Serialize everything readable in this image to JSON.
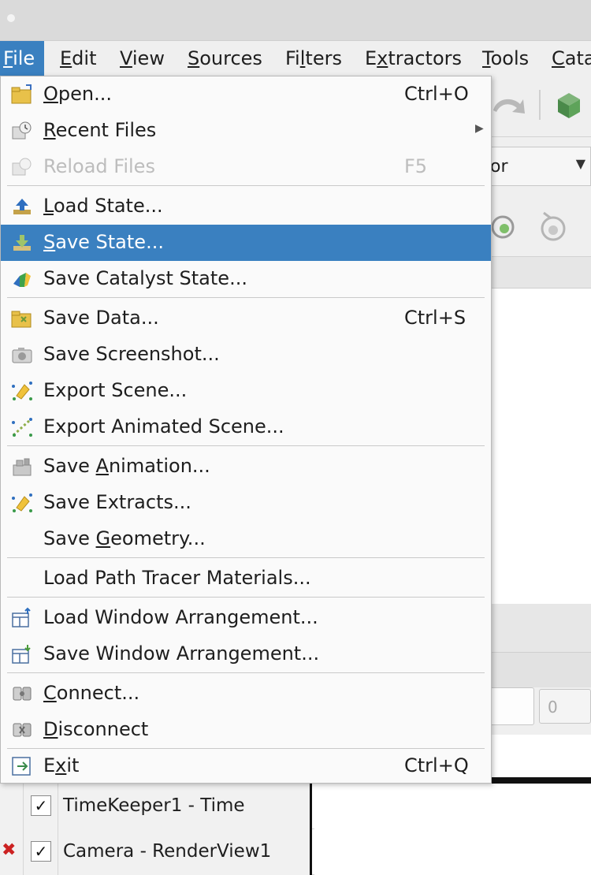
{
  "menubar": {
    "items": [
      {
        "pre": "",
        "u": "F",
        "post": "ile"
      },
      {
        "pre": "",
        "u": "E",
        "post": "dit"
      },
      {
        "pre": "",
        "u": "V",
        "post": "iew"
      },
      {
        "pre": "",
        "u": "S",
        "post": "ources"
      },
      {
        "pre": "Fi",
        "u": "l",
        "post": "ters"
      },
      {
        "pre": "E",
        "u": "x",
        "post": "tractors"
      },
      {
        "pre": "",
        "u": "T",
        "post": "ools"
      },
      {
        "pre": "",
        "u": "C",
        "post": "ata"
      }
    ]
  },
  "file_menu": {
    "items": [
      {
        "pre": "",
        "u": "O",
        "post": "pen...",
        "shortcut": "Ctrl+O",
        "icon": "folder-open-icon"
      },
      {
        "pre": "",
        "u": "R",
        "post": "ecent Files",
        "shortcut": "",
        "icon": "recent-files-icon"
      },
      {
        "pre": "Reload Files",
        "u": "",
        "post": "",
        "shortcut": "F5",
        "icon": "reload-files-icon"
      },
      {
        "pre": "",
        "u": "L",
        "post": "oad State...",
        "shortcut": "",
        "icon": "load-state-icon"
      },
      {
        "pre": "",
        "u": "S",
        "post": "ave State...",
        "shortcut": "",
        "icon": "save-state-icon"
      },
      {
        "pre": "Save Catalyst State...",
        "u": "",
        "post": "",
        "shortcut": "",
        "icon": "catalyst-icon"
      },
      {
        "pre": "Save Data...",
        "u": "",
        "post": "",
        "shortcut": "Ctrl+S",
        "icon": "save-data-icon"
      },
      {
        "pre": "Save Screenshot...",
        "u": "",
        "post": "",
        "shortcut": "",
        "icon": "screenshot-icon"
      },
      {
        "pre": "Export Scene...",
        "u": "",
        "post": "",
        "shortcut": "",
        "icon": "export-scene-icon"
      },
      {
        "pre": "Export Animated Scene...",
        "u": "",
        "post": "",
        "shortcut": "",
        "icon": "export-animated-scene-icon"
      },
      {
        "pre": "Save ",
        "u": "A",
        "post": "nimation...",
        "shortcut": "",
        "icon": "save-animation-icon"
      },
      {
        "pre": "Save Extracts...",
        "u": "",
        "post": "",
        "shortcut": "",
        "icon": "save-extracts-icon"
      },
      {
        "pre": "Save ",
        "u": "G",
        "post": "eometry...",
        "shortcut": "",
        "icon": ""
      },
      {
        "pre": "Load Path Tracer Materials...",
        "u": "",
        "post": "",
        "shortcut": "",
        "icon": ""
      },
      {
        "pre": "Load Window Arrangement...",
        "u": "",
        "post": "",
        "shortcut": "",
        "icon": "load-window-arrangement-icon"
      },
      {
        "pre": "Save Window Arrangement...",
        "u": "",
        "post": "",
        "shortcut": "",
        "icon": "save-window-arrangement-icon"
      },
      {
        "pre": "",
        "u": "C",
        "post": "onnect...",
        "shortcut": "",
        "icon": "connect-icon"
      },
      {
        "pre": "",
        "u": "D",
        "post": "isconnect",
        "shortcut": "",
        "icon": "disconnect-icon"
      },
      {
        "pre": "E",
        "u": "x",
        "post": "it",
        "shortcut": "Ctrl+Q",
        "icon": "exit-icon"
      }
    ]
  },
  "background": {
    "combo_text": "or",
    "field_value": "0"
  },
  "tree": {
    "rows": [
      {
        "label": "TimeKeeper1 - Time",
        "checked": "✓"
      },
      {
        "label": "Camera - RenderView1",
        "checked": "✓"
      }
    ]
  },
  "colors": {
    "highlight": "#3a80c0",
    "disabled_text": "#bdbdbd",
    "remove_mark": "#cc2222"
  }
}
